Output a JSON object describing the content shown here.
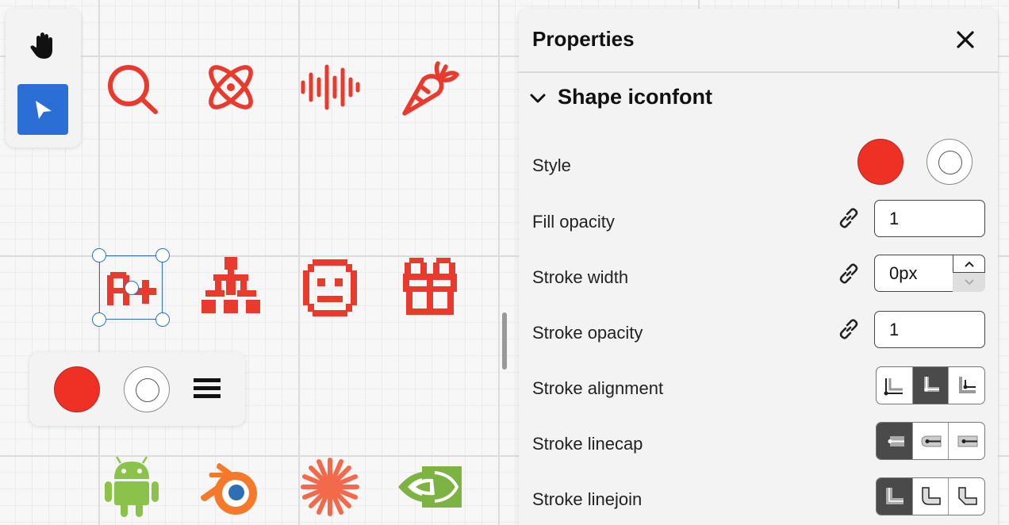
{
  "tools": {
    "hand_icon": "hand-icon",
    "select_icon": "pointer-icon"
  },
  "canvas": {
    "icons": [
      "search-icon",
      "atom-icon",
      "audio-wave-icon",
      "carrot-icon",
      "a-plus-icon",
      "sitemap-icon",
      "face-icon",
      "gift-icon",
      "android-icon",
      "blender-icon",
      "sparkle-icon",
      "nvidia-icon"
    ],
    "selected_icon": "a-plus-icon"
  },
  "floating_toolbar": {
    "fill_color": "#ee3124",
    "stroke_color": "#ffffff"
  },
  "properties": {
    "title": "Properties",
    "section_title": "Shape iconfont",
    "rows": {
      "style": "Style",
      "fill_opacity": "Fill opacity",
      "stroke_width": "Stroke width",
      "stroke_opacity": "Stroke opacity",
      "stroke_alignment": "Stroke alignment",
      "stroke_linecap": "Stroke linecap",
      "stroke_linejoin": "Stroke linejoin"
    },
    "values": {
      "fill_opacity": "1",
      "stroke_width": "0px",
      "stroke_opacity": "1"
    },
    "style_fill_color": "#ee3124",
    "stroke_alignment_selected": 1,
    "stroke_linecap_selected": 0,
    "stroke_linejoin_selected": 0
  },
  "colors": {
    "accent": "#2b6fd6",
    "icon_red": "#e83b2e",
    "android_green": "#8bc34a",
    "blender_orange": "#f5792a",
    "sparkle_orange": "#f26a4b",
    "nvidia_green": "#7cb342"
  }
}
